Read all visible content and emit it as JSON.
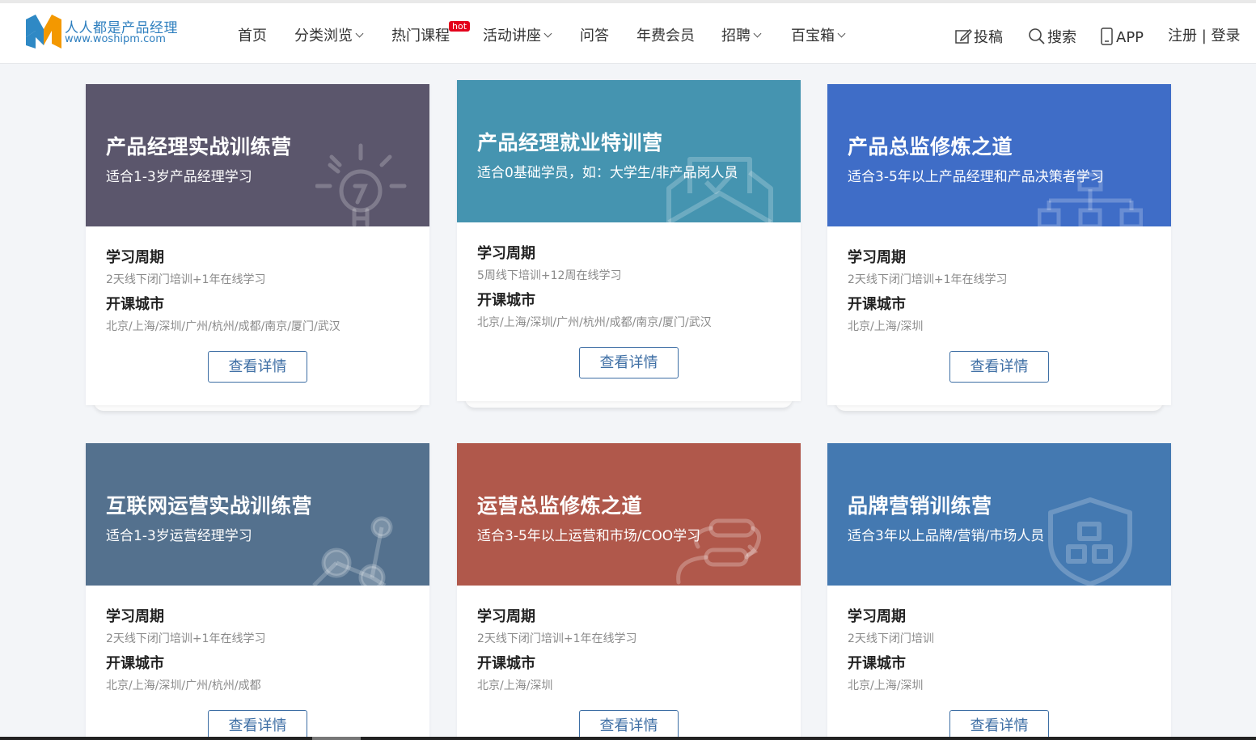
{
  "logo": {
    "name_cn": "人人都是产品经理",
    "domain": "www.woshipm.com"
  },
  "nav": [
    {
      "label": "首页",
      "dropdown": false
    },
    {
      "label": "分类浏览",
      "dropdown": true
    },
    {
      "label": "热门课程",
      "dropdown": false,
      "badge": "hot"
    },
    {
      "label": "活动讲座",
      "dropdown": true
    },
    {
      "label": "问答",
      "dropdown": false
    },
    {
      "label": "年费会员",
      "dropdown": false
    },
    {
      "label": "招聘",
      "dropdown": true
    },
    {
      "label": "百宝箱",
      "dropdown": true
    }
  ],
  "tools": {
    "post": "投稿",
    "search": "搜索",
    "app": "APP",
    "auth": "注册 | 登录"
  },
  "labels": {
    "period": "学习周期",
    "city": "开课城市",
    "button": "查看详情"
  },
  "cards": [
    {
      "title": "产品经理实战训练营",
      "subtitle": "适合1-3岁产品经理学习",
      "period": "2天线下闭门培训+1年在线学习",
      "cities": "北京/上海/深圳/广州/杭州/成都/南京/厦门/武汉",
      "color": "#5b566c",
      "icon": "lightbulb-icon"
    },
    {
      "title": "产品经理就业特训营",
      "subtitle": "适合0基础学员，如：大学生/非产品岗人员",
      "period": "5周线下培训+12周在线学习",
      "cities": "北京/上海/深圳/广州/杭州/成都/南京/厦门/武汉",
      "color": "#4594b0",
      "icon": "envelope-check-icon"
    },
    {
      "title": "产品总监修炼之道",
      "subtitle": "适合3-5年以上产品经理和产品决策者学习",
      "period": "2天线下闭门培训+1年在线学习",
      "cities": "北京/上海/深圳",
      "color": "#3f6dc7",
      "icon": "org-chart-icon"
    },
    {
      "title": "互联网运营实战训练营",
      "subtitle": "适合1-3岁运营经理学习",
      "period": "2天线下闭门培训+1年在线学习",
      "cities": "北京/上海/深圳/广州/杭州/成都",
      "color": "#54718e",
      "icon": "molecule-icon"
    },
    {
      "title": "运营总监修炼之道",
      "subtitle": "适合3-5年以上运营和市场/COO学习",
      "period": "2天线下闭门培训+1年在线学习",
      "cities": "北京/上海/深圳",
      "color": "#b0584b",
      "icon": "flow-icon"
    },
    {
      "title": "品牌营销训练营",
      "subtitle": "适合3年以上品牌/营销/市场人员",
      "period": "2天线下闭门培训",
      "cities": "北京/上海/深圳",
      "color": "#4479b1",
      "icon": "shield-icon"
    }
  ]
}
